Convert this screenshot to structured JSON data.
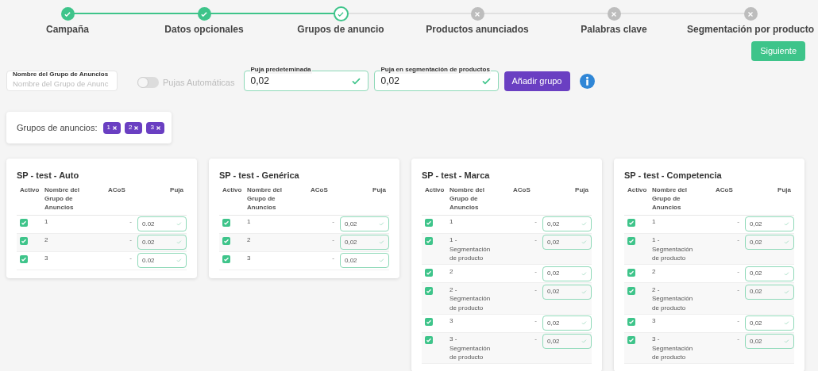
{
  "steps": [
    {
      "label": "Campaña",
      "done": true,
      "current": false
    },
    {
      "label": "Datos opcionales",
      "done": true,
      "current": false
    },
    {
      "label": "Grupos de anuncio",
      "done": false,
      "current": true
    },
    {
      "label": "Productos anunciados",
      "done": false,
      "current": false
    },
    {
      "label": "Palabras clave",
      "done": false,
      "current": false
    },
    {
      "label": "Segmentación por producto",
      "done": false,
      "current": false
    }
  ],
  "next_button": "Siguiente",
  "form": {
    "name_field": {
      "label": "Nombre del Grupo de Anuncios",
      "placeholder": "Nombre del Grupo de Anunc"
    },
    "auto_bids": {
      "label": "Pujas Automáticas",
      "on": false
    },
    "default_bid": {
      "label": "Puja predeteminada",
      "value": "0,02",
      "valid": true
    },
    "product_bid": {
      "label": "Puja en segmentación de productos",
      "value": "0,02",
      "valid": true
    },
    "add_button": "Añadir grupo"
  },
  "groups": {
    "label": "Grupos de anuncios:",
    "chips": [
      "1",
      "2",
      "3"
    ]
  },
  "campaigns": [
    {
      "title": "SP - test - Auto",
      "columns": [
        "Activo",
        "Nombre del Grupo de Anuncios",
        "ACoS",
        "Puja"
      ],
      "rows": [
        {
          "active": true,
          "name": "1",
          "acos": "-",
          "bid": "0.02"
        },
        {
          "active": true,
          "name": "2",
          "acos": "-",
          "bid": "0.02"
        },
        {
          "active": true,
          "name": "3",
          "acos": "-",
          "bid": "0.02"
        }
      ]
    },
    {
      "title": "SP - test - Genérica",
      "columns": [
        "Activo",
        "Nombre del Grupo de Anuncios",
        "ACoS",
        "Puja"
      ],
      "rows": [
        {
          "active": true,
          "name": "1",
          "acos": "-",
          "bid": "0,02"
        },
        {
          "active": true,
          "name": "2",
          "acos": "-",
          "bid": "0,02"
        },
        {
          "active": true,
          "name": "3",
          "acos": "-",
          "bid": "0,02"
        }
      ]
    },
    {
      "title": "SP - test - Marca",
      "columns": [
        "Activo",
        "Nombre del Grupo de Anuncios",
        "ACoS",
        "Puja"
      ],
      "rows": [
        {
          "active": true,
          "name": "1",
          "acos": "-",
          "bid": "0,02"
        },
        {
          "active": true,
          "name": "1 - Segmentación de producto",
          "acos": "-",
          "bid": "0,02"
        },
        {
          "active": true,
          "name": "2",
          "acos": "-",
          "bid": "0,02"
        },
        {
          "active": true,
          "name": "2 - Segmentación de producto",
          "acos": "-",
          "bid": "0,02"
        },
        {
          "active": true,
          "name": "3",
          "acos": "-",
          "bid": "0,02"
        },
        {
          "active": true,
          "name": "3 - Segmentación de producto",
          "acos": "-",
          "bid": "0,02"
        }
      ]
    },
    {
      "title": "SP - test - Competencia",
      "columns": [
        "Activo",
        "Nombre del Grupo de Anuncios",
        "ACoS",
        "Puja"
      ],
      "rows": [
        {
          "active": true,
          "name": "1",
          "acos": "-",
          "bid": "0,02"
        },
        {
          "active": true,
          "name": "1 - Segmentación de producto",
          "acos": "-",
          "bid": "0,02"
        },
        {
          "active": true,
          "name": "2",
          "acos": "-",
          "bid": "0,02"
        },
        {
          "active": true,
          "name": "2 - Segmentación de producto",
          "acos": "-",
          "bid": "0,02"
        },
        {
          "active": true,
          "name": "3",
          "acos": "-",
          "bid": "0,02"
        },
        {
          "active": true,
          "name": "3 - Segmentación de producto",
          "acos": "-",
          "bid": "0,02"
        }
      ]
    }
  ]
}
